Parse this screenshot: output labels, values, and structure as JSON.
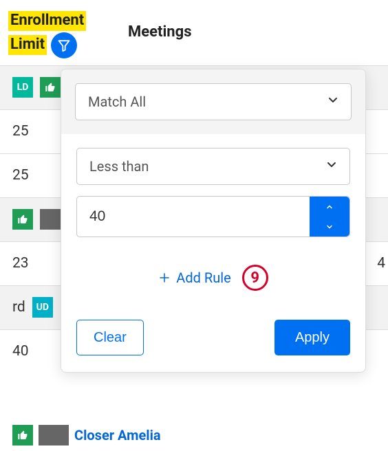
{
  "columns": {
    "enrollment_line1": "Enrollment",
    "enrollment_line2": "Limit",
    "meetings": "Meetings"
  },
  "rows": [
    {
      "gray": true,
      "badgeLD": "LD",
      "thumb": true,
      "num": ""
    },
    {
      "gray": false,
      "num": "25"
    },
    {
      "gray": false,
      "num": "25"
    },
    {
      "gray": true,
      "thumb": true,
      "dark": true,
      "num": ""
    },
    {
      "gray": false,
      "num": "23",
      "right": "4"
    },
    {
      "gray": true,
      "prefix": "rd",
      "badgeUD": "UD",
      "num": ""
    },
    {
      "gray": false,
      "num": "40"
    }
  ],
  "filter": {
    "match_mode": "Match All",
    "operator": "Less than",
    "value": "40",
    "add_rule": "Add Rule",
    "step_badge": "9",
    "clear": "Clear",
    "apply": "Apply"
  },
  "bottom": {
    "name_fragment": "Closer Amelia"
  }
}
